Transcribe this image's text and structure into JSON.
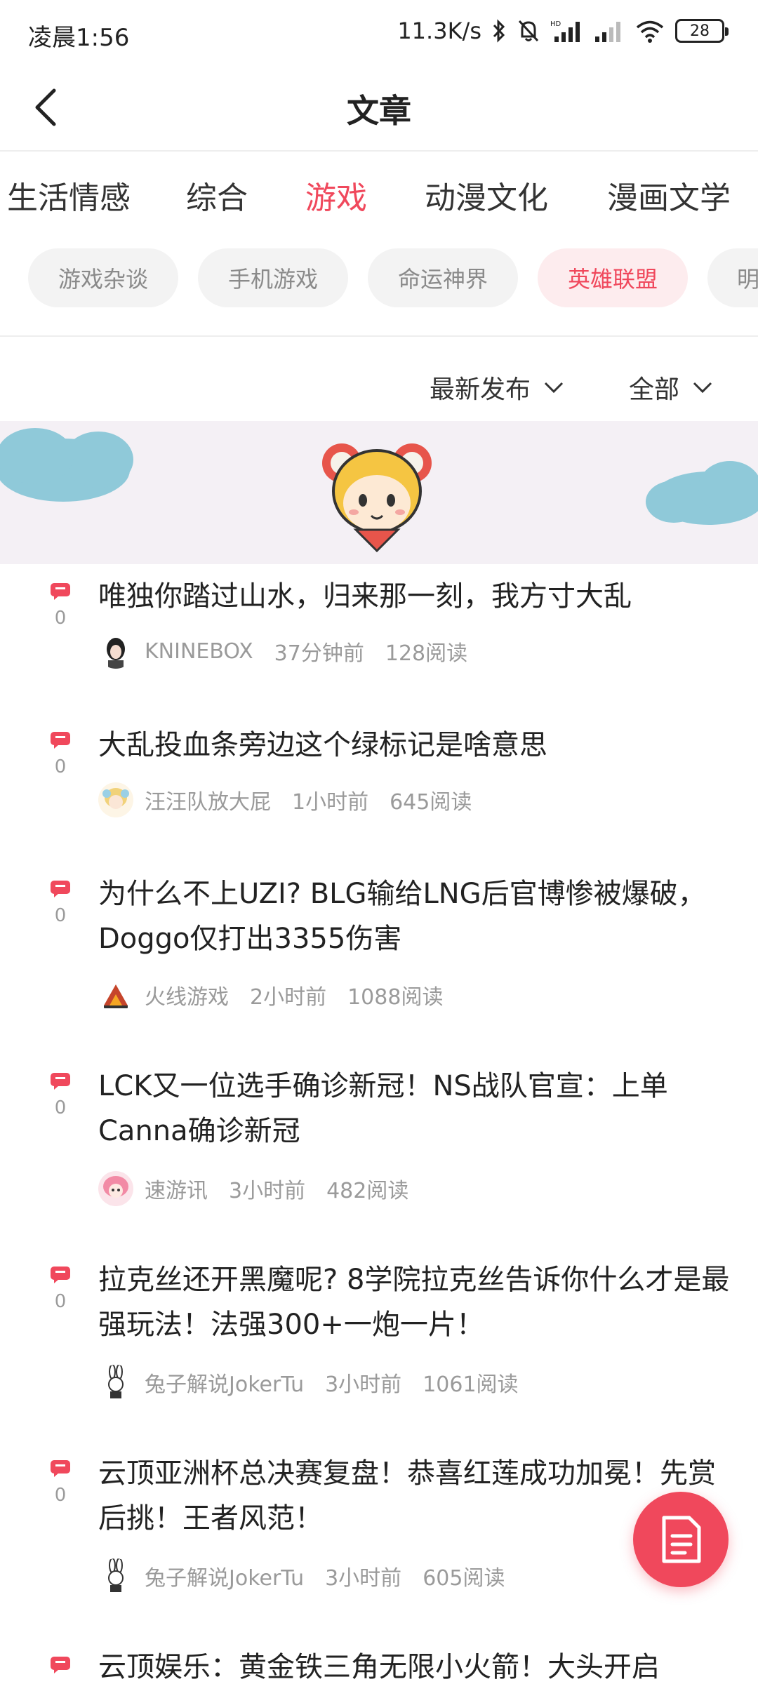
{
  "status_bar": {
    "time": "凌晨1:56",
    "net_speed": "11.3K/s",
    "signal_label": "HD",
    "battery_level": "28"
  },
  "header": {
    "title": "文章",
    "back_icon": "chevron-left-icon"
  },
  "tabs": [
    {
      "label": "生活情感",
      "active": false
    },
    {
      "label": "综合",
      "active": false
    },
    {
      "label": "游戏",
      "active": true
    },
    {
      "label": "动漫文化",
      "active": false
    },
    {
      "label": "漫画文学",
      "active": false
    }
  ],
  "chips": [
    {
      "label": "游戏杂谈",
      "active": false
    },
    {
      "label": "手机游戏",
      "active": false
    },
    {
      "label": "命运神界",
      "active": false
    },
    {
      "label": "英雄联盟",
      "active": true
    },
    {
      "label": "明",
      "active": false
    }
  ],
  "filters": {
    "sort": "最新发布",
    "scope": "全部"
  },
  "articles": [
    {
      "title": "唯独你踏过山水，归来那一刻，我方寸大乱",
      "author": "KNINEBOX",
      "time": "37分钟前",
      "reads": "128阅读",
      "comments": "0"
    },
    {
      "title": "大乱投血条旁边这个绿标记是啥意思",
      "author": "汪汪队放大屁",
      "time": "1小时前",
      "reads": "645阅读",
      "comments": "0"
    },
    {
      "title": "为什么不上UZI? BLG输给LNG后官博惨被爆破，Doggo仅打出3355伤害",
      "author": "火线游戏",
      "time": "2小时前",
      "reads": "1088阅读",
      "comments": "0"
    },
    {
      "title": "LCK又一位选手确诊新冠！NS战队官宣：上单Canna确诊新冠",
      "author": "速游讯",
      "time": "3小时前",
      "reads": "482阅读",
      "comments": "0"
    },
    {
      "title": "拉克丝还开黑魔呢? 8学院拉克丝告诉你什么才是最强玩法！法强300+一炮一片！",
      "author": "兔子解说JokerTu",
      "time": "3小时前",
      "reads": "1061阅读",
      "comments": "0"
    },
    {
      "title": "云顶亚洲杯总决赛复盘！恭喜红莲成功加冕！先赏后挑！王者风范！",
      "author": "兔子解说JokerTu",
      "time": "3小时前",
      "reads": "605阅读",
      "comments": "0"
    },
    {
      "title": "云顶娱乐：黄金铁三角无限小火箭！大头开启",
      "author": "",
      "time": "",
      "reads": "",
      "comments": ""
    }
  ],
  "colors": {
    "accent": "#f0485c",
    "chip_bg": "#f3f3f3",
    "banner_bg": "#f4f0f5"
  },
  "fab": {
    "icon": "document-icon"
  }
}
